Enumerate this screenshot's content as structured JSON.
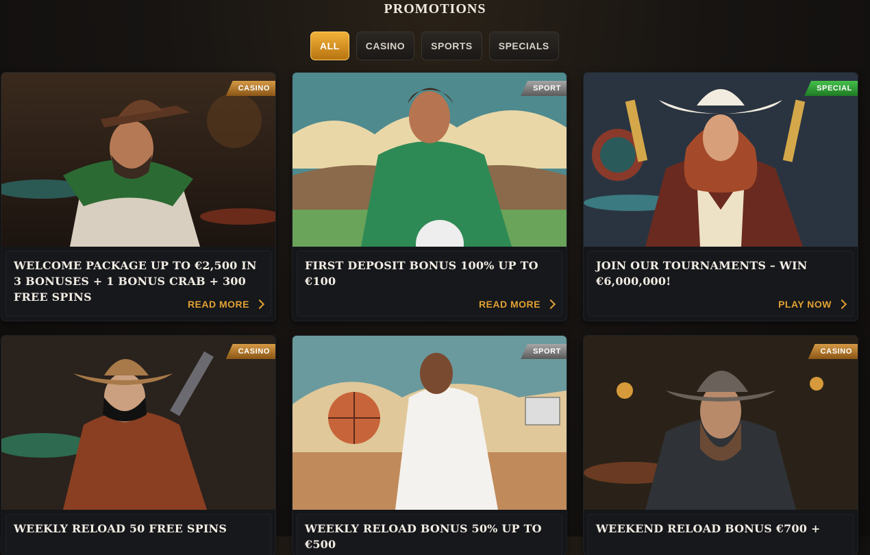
{
  "page": {
    "title": "PROMOTIONS"
  },
  "filters": [
    {
      "label": "ALL",
      "active": true
    },
    {
      "label": "CASINO",
      "active": false
    },
    {
      "label": "SPORTS",
      "active": false
    },
    {
      "label": "SPECIALS",
      "active": false
    }
  ],
  "promotions": [
    {
      "tag": "CASINO",
      "title": "WELCOME PACKAGE UP TO €2,500 IN 3 BONUSES + 1 BONUS CRAB + 300 FREE SPINS",
      "cta": "READ MORE",
      "image": "cowboy-green-scarf"
    },
    {
      "tag": "SPORT",
      "title": "FIRST DEPOSIT BONUS 100% UP TO €100",
      "cta": "READ MORE",
      "image": "soccer-player"
    },
    {
      "tag": "SPECIAL",
      "title": "JOIN OUR TOURNAMENTS – WIN €6,000,000!",
      "cta": "PLAY NOW",
      "image": "cowgirl-revolvers"
    },
    {
      "tag": "CASINO",
      "title": "WEEKLY RELOAD 50 FREE SPINS",
      "cta": "",
      "image": "masked-outlaw"
    },
    {
      "tag": "SPORT",
      "title": "WEEKLY RELOAD BONUS 50% UP TO €500",
      "cta": "",
      "image": "basketball-player"
    },
    {
      "tag": "CASINO",
      "title": "WEEKEND RELOAD BONUS €700 +",
      "cta": "",
      "image": "bearded-gunslinger"
    }
  ],
  "colors": {
    "accent": "#e2a133",
    "casino_tag": "#b87a2a",
    "sport_tag": "#7d7d7d",
    "special_tag": "#2e9b33"
  }
}
